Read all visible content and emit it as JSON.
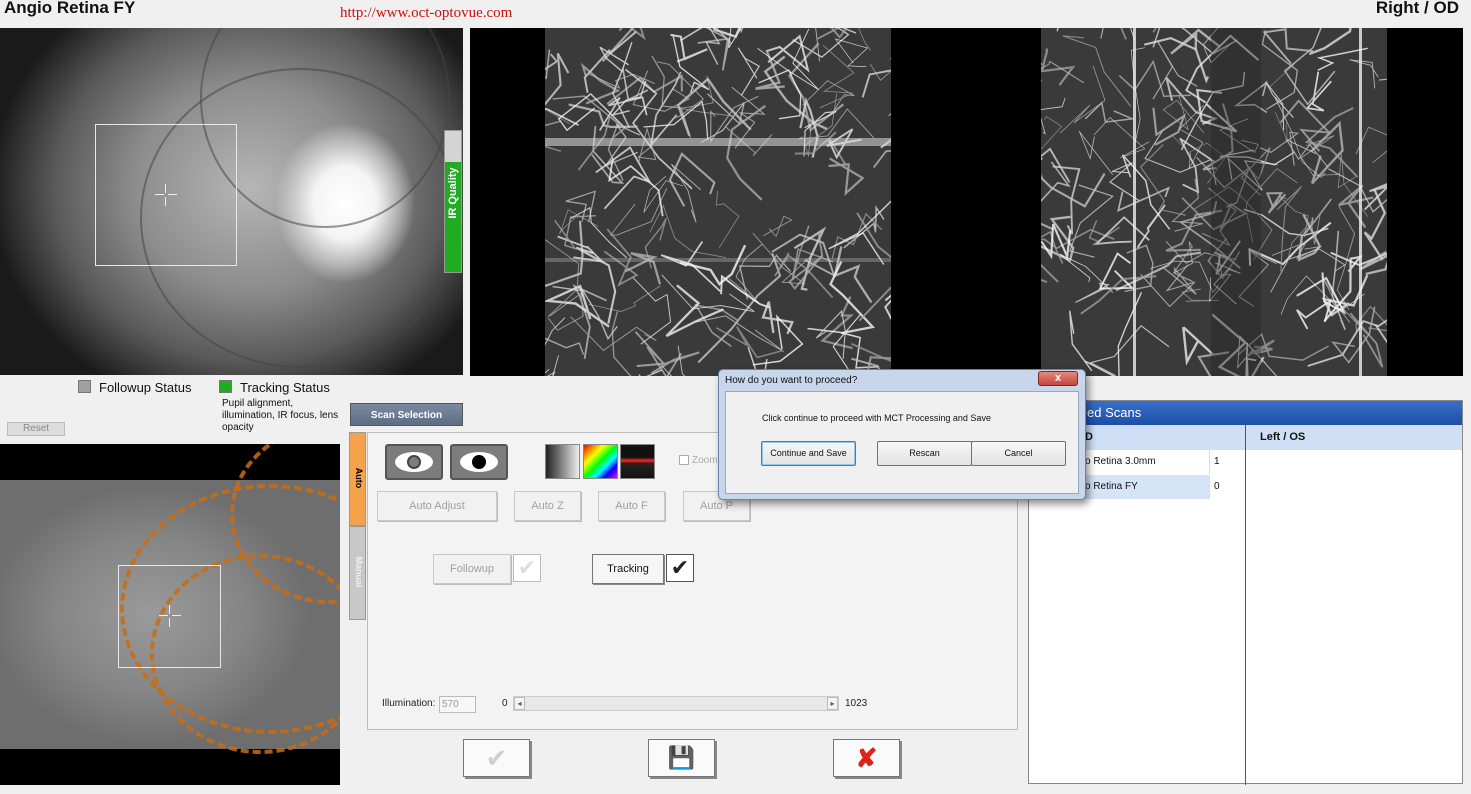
{
  "header": {
    "scan_name": "Angio Retina FY",
    "url": "http://www.oct-optovue.com",
    "eye": "Right / OD"
  },
  "ir_quality": {
    "label": "IR Quality",
    "level": 0.78,
    "color": "#22aa22"
  },
  "status": {
    "followup_label": "Followup Status",
    "followup_color": "#a0a0a0",
    "tracking_label": "Tracking Status",
    "tracking_color": "#22aa22",
    "tracking_note": "Pupil alignment, illumination, IR focus, lens opacity"
  },
  "reset_label": "Reset",
  "scan_selection_label": "Scan Selection",
  "side_tabs": {
    "auto": "Auto",
    "manual": "Manual"
  },
  "controls": {
    "zoom_label": "Zoom",
    "auto_adjust": "Auto Adjust",
    "auto_z": "Auto Z",
    "auto_f": "Auto F",
    "auto_p": "Auto P",
    "followup": "Followup",
    "tracking": "Tracking",
    "tracking_checked": "✔",
    "followup_checked": "✔",
    "illumination_label": "Illumination:",
    "illumination_value": "570",
    "slider_min": "0",
    "slider_max": "1023",
    "slider_left_arrow": "◂",
    "slider_right_arrow": "▸"
  },
  "actions": {
    "accept": "✔",
    "save": "💾",
    "cancel": "✘"
  },
  "scans_table": {
    "header": "ed Scans",
    "col_right": "D",
    "col_left": "Left / OS",
    "rows": [
      {
        "name": "o Retina  3.0mm",
        "count": "1"
      },
      {
        "name": "o Retina FY",
        "count": "0"
      }
    ]
  },
  "dialog": {
    "title": "How do you want to proceed?",
    "close": "x",
    "message": "Click continue to proceed with MCT Processing and Save",
    "continue": "Continue and Save",
    "rescan": "Rescan",
    "cancel": "Cancel"
  }
}
